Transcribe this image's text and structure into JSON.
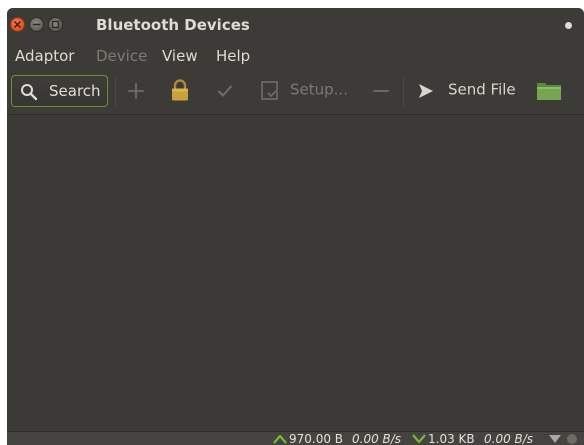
{
  "window": {
    "title": "Bluetooth Devices"
  },
  "menu": {
    "items": [
      {
        "label": "Adaptor",
        "enabled": true
      },
      {
        "label": "Device",
        "enabled": false
      },
      {
        "label": "View",
        "enabled": true
      },
      {
        "label": "Help",
        "enabled": true
      }
    ]
  },
  "toolbar": {
    "search_label": "Search",
    "add_icon": "plus-icon",
    "trust_icon": "lock-icon",
    "pair_icon": "checkmark-icon",
    "setup_label": "Setup...",
    "remove_icon": "minus-icon",
    "send_file_label": "Send File",
    "browse_icon": "folder-icon"
  },
  "status": {
    "upload_total": "970.00 B",
    "upload_rate": "0.00 B/s",
    "download_total": "1.03 KB",
    "download_rate": "0.00 B/s"
  },
  "colors": {
    "window_bg": "#3b3a36",
    "title_text": "#dfdbd2",
    "close_button": "#e25b2b",
    "search_border": "#6a8f3a",
    "lock_icon": "#c9a13b",
    "folder_icon": "#6f9a4a",
    "arrow_green": "#79b83a"
  }
}
